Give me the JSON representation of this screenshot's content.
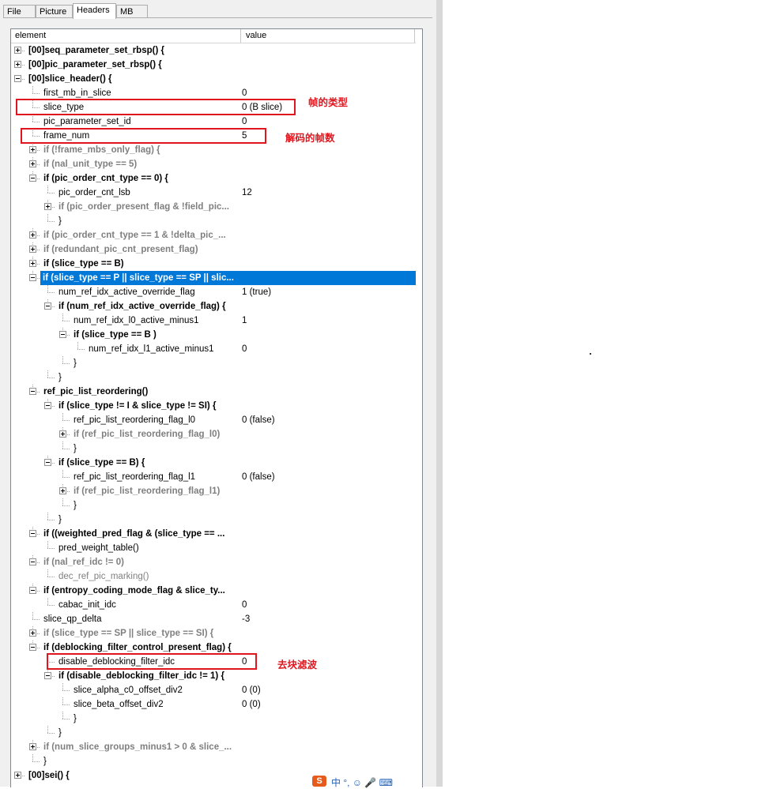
{
  "tabs": [
    "File",
    "Picture",
    "Headers",
    "MB"
  ],
  "selected_tab": "Headers",
  "columns": {
    "element": "element",
    "value": "value"
  },
  "rows": [
    {
      "label": "[00]seq_parameter_set_rbsp() {",
      "value": "",
      "style": "b",
      "expander": "plus",
      "indent": 0
    },
    {
      "label": "[00]pic_parameter_set_rbsp() {",
      "value": "",
      "style": "b",
      "expander": "plus",
      "indent": 0
    },
    {
      "label": "[00]slice_header() {",
      "value": "",
      "style": "b",
      "expander": "minus",
      "indent": 0
    },
    {
      "label": "first_mb_in_slice",
      "value": "0",
      "style": "",
      "expander": "",
      "indent": 1
    },
    {
      "label": "slice_type",
      "value": "0 (B slice)",
      "style": "",
      "expander": "",
      "indent": 1
    },
    {
      "label": "pic_parameter_set_id",
      "value": "0",
      "style": "",
      "expander": "",
      "indent": 1
    },
    {
      "label": "frame_num",
      "value": "5",
      "style": "",
      "expander": "",
      "indent": 1
    },
    {
      "label": "if (!frame_mbs_only_flag) {",
      "value": "",
      "style": "g b",
      "expander": "plus",
      "indent": 1
    },
    {
      "label": "if (nal_unit_type == 5)",
      "value": "",
      "style": "g b",
      "expander": "plus",
      "indent": 1
    },
    {
      "label": "if (pic_order_cnt_type == 0) {",
      "value": "",
      "style": "b",
      "expander": "minus",
      "indent": 1
    },
    {
      "label": "pic_order_cnt_lsb",
      "value": "12",
      "style": "",
      "expander": "",
      "indent": 2
    },
    {
      "label": "if (pic_order_present_flag & !field_pic...",
      "value": "",
      "style": "g b",
      "expander": "plus",
      "indent": 2
    },
    {
      "label": "}",
      "value": "",
      "style": "",
      "expander": "",
      "indent": 2
    },
    {
      "label": "if (pic_order_cnt_type == 1 & !delta_pic_...",
      "value": "",
      "style": "g b",
      "expander": "plus",
      "indent": 1
    },
    {
      "label": "if (redundant_pic_cnt_present_flag)",
      "value": "",
      "style": "g b",
      "expander": "plus",
      "indent": 1
    },
    {
      "label": "if (slice_type == B)",
      "value": "",
      "style": "b",
      "expander": "plus",
      "indent": 1
    },
    {
      "label": "if (slice_type == P || slice_type == SP || slic...",
      "value": "",
      "style": "b",
      "expander": "minus",
      "indent": 1,
      "selected": true
    },
    {
      "label": "num_ref_idx_active_override_flag",
      "value": "1 (true)",
      "style": "",
      "expander": "",
      "indent": 2
    },
    {
      "label": "if (num_ref_idx_active_override_flag) {",
      "value": "",
      "style": "b",
      "expander": "minus",
      "indent": 2
    },
    {
      "label": "num_ref_idx_l0_active_minus1",
      "value": "1",
      "style": "",
      "expander": "",
      "indent": 3
    },
    {
      "label": "if (slice_type == B )",
      "value": "",
      "style": "b",
      "expander": "minus",
      "indent": 3
    },
    {
      "label": "num_ref_idx_l1_active_minus1",
      "value": "0",
      "style": "",
      "expander": "",
      "indent": 4
    },
    {
      "label": "}",
      "value": "",
      "style": "",
      "expander": "",
      "indent": 3
    },
    {
      "label": "}",
      "value": "",
      "style": "",
      "expander": "",
      "indent": 2
    },
    {
      "label": "ref_pic_list_reordering()",
      "value": "",
      "style": "b",
      "expander": "minus",
      "indent": 1
    },
    {
      "label": "if (slice_type != I & slice_type != SI) {",
      "value": "",
      "style": "b",
      "expander": "minus",
      "indent": 2
    },
    {
      "label": "ref_pic_list_reordering_flag_l0",
      "value": "0 (false)",
      "style": "",
      "expander": "",
      "indent": 3
    },
    {
      "label": "if (ref_pic_list_reordering_flag_l0)",
      "value": "",
      "style": "g b",
      "expander": "plus",
      "indent": 3
    },
    {
      "label": "}",
      "value": "",
      "style": "",
      "expander": "",
      "indent": 3
    },
    {
      "label": "if (slice_type == B) {",
      "value": "",
      "style": "b",
      "expander": "minus",
      "indent": 2
    },
    {
      "label": "ref_pic_list_reordering_flag_l1",
      "value": "0 (false)",
      "style": "",
      "expander": "",
      "indent": 3
    },
    {
      "label": "if (ref_pic_list_reordering_flag_l1)",
      "value": "",
      "style": "g b",
      "expander": "plus",
      "indent": 3
    },
    {
      "label": "}",
      "value": "",
      "style": "",
      "expander": "",
      "indent": 3
    },
    {
      "label": "}",
      "value": "",
      "style": "",
      "expander": "",
      "indent": 2
    },
    {
      "label": "if ((weighted_pred_flag & (slice_type == ...",
      "value": "",
      "style": "b",
      "expander": "minus",
      "indent": 1
    },
    {
      "label": "pred_weight_table()",
      "value": "",
      "style": "",
      "expander": "",
      "indent": 2
    },
    {
      "label": "if (nal_ref_idc != 0)",
      "value": "",
      "style": "g b",
      "expander": "minus",
      "indent": 1
    },
    {
      "label": "dec_ref_pic_marking()",
      "value": "",
      "style": "g",
      "expander": "",
      "indent": 2
    },
    {
      "label": "if (entropy_coding_mode_flag & slice_ty...",
      "value": "",
      "style": "b",
      "expander": "minus",
      "indent": 1
    },
    {
      "label": "cabac_init_idc",
      "value": "0",
      "style": "",
      "expander": "",
      "indent": 2
    },
    {
      "label": "slice_qp_delta",
      "value": "-3",
      "style": "",
      "expander": "",
      "indent": 1
    },
    {
      "label": "if (slice_type == SP || slice_type == SI) {",
      "value": "",
      "style": "g b",
      "expander": "plus",
      "indent": 1
    },
    {
      "label": "if (deblocking_filter_control_present_flag) {",
      "value": "",
      "style": "b",
      "expander": "minus",
      "indent": 1
    },
    {
      "label": "disable_deblocking_filter_idc",
      "value": "0",
      "style": "",
      "expander": "",
      "indent": 2
    },
    {
      "label": "if (disable_deblocking_filter_idc != 1) {",
      "value": "",
      "style": "b",
      "expander": "minus",
      "indent": 2
    },
    {
      "label": "slice_alpha_c0_offset_div2",
      "value": "0 (0)",
      "style": "",
      "expander": "",
      "indent": 3
    },
    {
      "label": "slice_beta_offset_div2",
      "value": "0 (0)",
      "style": "",
      "expander": "",
      "indent": 3
    },
    {
      "label": "}",
      "value": "",
      "style": "",
      "expander": "",
      "indent": 3
    },
    {
      "label": "}",
      "value": "",
      "style": "",
      "expander": "",
      "indent": 2
    },
    {
      "label": "if (num_slice_groups_minus1 > 0 & slice_...",
      "value": "",
      "style": "g b",
      "expander": "plus",
      "indent": 1
    },
    {
      "label": "}",
      "value": "",
      "style": "",
      "expander": "",
      "indent": 1
    },
    {
      "label": "[00]sei() {",
      "value": "",
      "style": "b",
      "expander": "plus",
      "indent": 0
    }
  ],
  "annotations": {
    "slice_type_note": "帧的类型",
    "frame_num_note": "解码的帧数",
    "deblock_note": "去块滤波"
  },
  "ime_bar": {
    "logo": "S",
    "text": "中 °, ☺ 🎤 ⌨"
  },
  "colors": {
    "selection": "#0078d7",
    "annotation": "#e0161e"
  }
}
